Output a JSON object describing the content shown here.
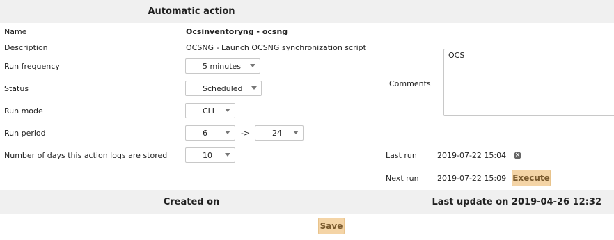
{
  "header": {
    "title": "Automatic action"
  },
  "fields": {
    "name_label": "Name",
    "name_value": "Ocsinventoryng - ocsng",
    "description_label": "Description",
    "description_value": "OCSNG - Launch OCSNG synchronization script",
    "run_frequency_label": "Run frequency",
    "run_frequency_value": "5 minutes",
    "status_label": "Status",
    "status_value": "Scheduled",
    "run_mode_label": "Run mode",
    "run_mode_value": "CLI",
    "run_period_label": "Run period",
    "run_period_from": "6",
    "run_period_separator": "->",
    "run_period_to": "24",
    "logs_days_label": "Number of days this action logs are stored",
    "logs_days_value": "10"
  },
  "comments": {
    "label": "Comments",
    "value": "OCS"
  },
  "runs": {
    "last_run_label": "Last run",
    "last_run_value": "2019-07-22 15:04",
    "next_run_label": "Next run",
    "next_run_value": "2019-07-22 15:09",
    "execute_label": "Execute"
  },
  "footer": {
    "created_on_label": "Created on",
    "last_update_label": "Last update on 2019-04-26 12:32",
    "save_label": "Save"
  },
  "colors": {
    "band_background": "#f0f0f0",
    "button_background": "#f4d4a6",
    "button_text": "#7a5a2e"
  },
  "icons": {
    "select_caret": "chevron-down-icon",
    "clear_last_run": "close-icon"
  }
}
